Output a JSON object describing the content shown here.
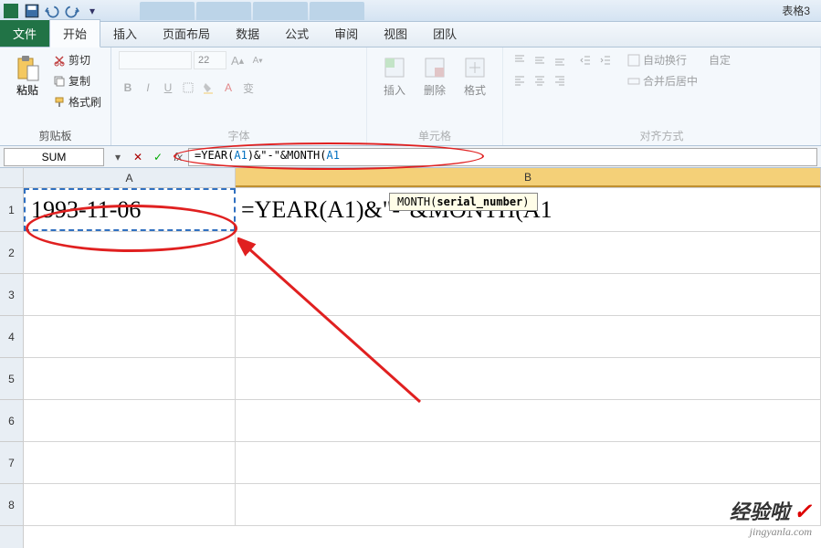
{
  "window": {
    "title": "表格3"
  },
  "tabs": {
    "file": "文件",
    "items": [
      "开始",
      "插入",
      "页面布局",
      "数据",
      "公式",
      "审阅",
      "视图",
      "团队"
    ],
    "active_index": 0
  },
  "ribbon": {
    "clipboard": {
      "title": "剪贴板",
      "paste": "粘贴",
      "cut": "剪切",
      "copy": "复制",
      "format_painter": "格式刷"
    },
    "font": {
      "title": "字体",
      "bold": "B",
      "italic": "I",
      "underline": "U",
      "font_name": "",
      "font_size": "22",
      "larger": "A",
      "smaller": "A"
    },
    "cells": {
      "title": "单元格",
      "insert": "插入",
      "delete": "删除",
      "format": "格式"
    },
    "align": {
      "title": "对齐方式",
      "wrap": "自动换行",
      "merge": "合并后居中",
      "auto_set": "自定"
    }
  },
  "formula_bar": {
    "name_box": "SUM",
    "formula": "=YEAR(A1)&\"-\"&MONTH(A1"
  },
  "tooltip": {
    "prefix": "MONTH(",
    "arg": "serial_number",
    "suffix": ")"
  },
  "grid": {
    "columns": [
      "A",
      "B"
    ],
    "rows": [
      "1",
      "2",
      "3",
      "4",
      "5",
      "6",
      "7",
      "8"
    ],
    "cells": {
      "A1": "1993-11-06",
      "B1": "=YEAR(A1)&\"-\"&MONTH(A1"
    }
  },
  "watermark": {
    "brand": "经验啦",
    "check": "✓",
    "url": "jingyanla.com"
  },
  "icons": {
    "save": "save",
    "undo": "undo",
    "redo": "redo"
  }
}
